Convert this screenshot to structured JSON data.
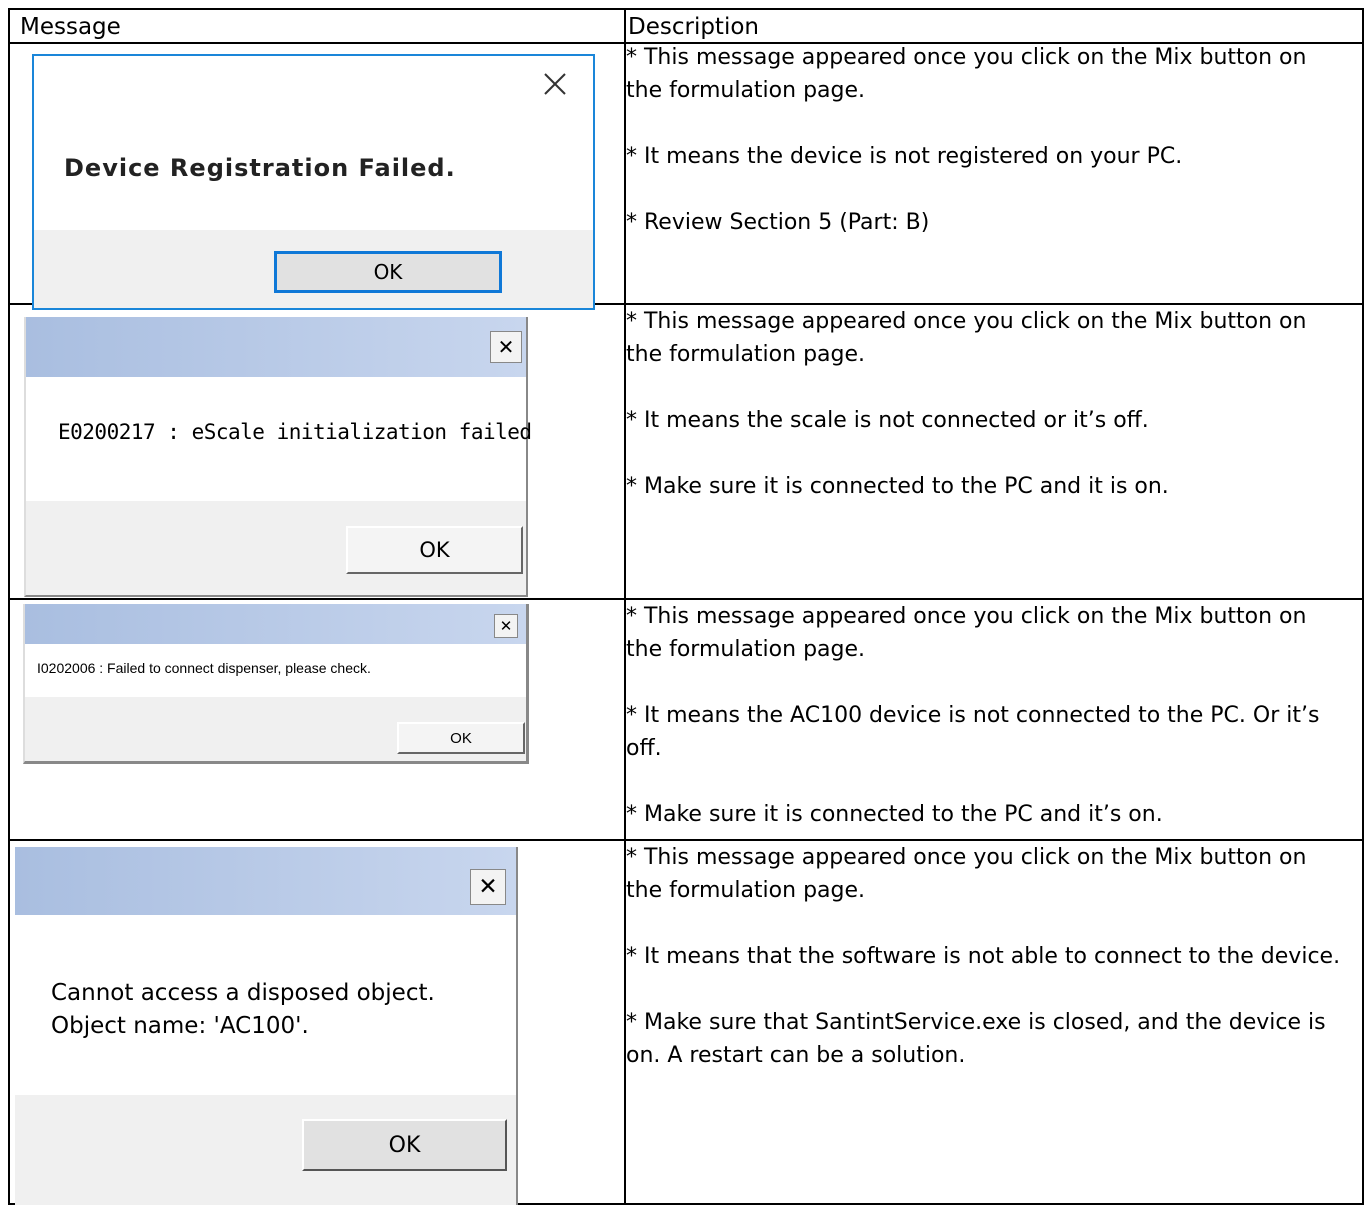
{
  "table": {
    "headers": {
      "message": "Message",
      "description": "Description"
    }
  },
  "rows": [
    {
      "dialog": {
        "message": "Device Registration Failed.",
        "ok_label": "OK",
        "close_icon": "close-icon"
      },
      "description": [
        "* This message appeared once you click on the Mix button on the formulation page.",
        "* It means the device is not registered on your PC.",
        "* Review Section 5 (Part: B)"
      ]
    },
    {
      "dialog": {
        "message": "E0200217 : eScale initialization failed",
        "ok_label": "OK",
        "close_icon": "close-icon"
      },
      "description": [
        "* This message appeared once you click on the Mix button on the formulation page.",
        "* It means the scale is not connected or it’s off.",
        "* Make sure it is connected to the PC and it is on."
      ]
    },
    {
      "dialog": {
        "message": "I0202006 : Failed to connect dispenser, please check.",
        "ok_label": "OK",
        "close_icon": "close-icon"
      },
      "description": [
        "* This message appeared once you click on the Mix button on the formulation page.",
        "* It means the AC100 device is not connected to the PC. Or it’s off.",
        "* Make sure it is connected to the PC and it’s on."
      ]
    },
    {
      "dialog": {
        "message_line1": "Cannot access a disposed object.",
        "message_line2": "Object name: 'AC100'.",
        "ok_label": "OK",
        "close_icon": "close-icon"
      },
      "description": [
        "* This message appeared once you click on the Mix button on the formulation page.",
        "* It means that the software is not able to connect to the device.",
        "* Make sure that SantintService.exe is closed, and the device is on. A restart can be a solution."
      ]
    }
  ]
}
